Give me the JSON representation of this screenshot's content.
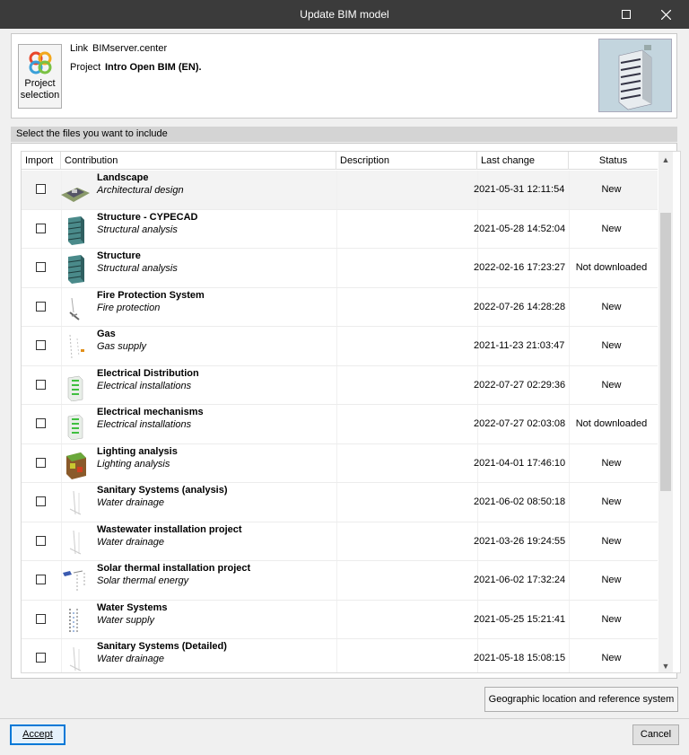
{
  "window": {
    "title": "Update BIM model"
  },
  "header": {
    "project_button_label": "Project\nselection",
    "link_label": "Link",
    "link_value": "BIMserver.center",
    "project_label": "Project",
    "project_value": "Intro Open BIM (EN)."
  },
  "section_title": "Select the files you want to include",
  "table": {
    "columns": [
      "Import",
      "Contribution",
      "Description",
      "Last change",
      "Status"
    ],
    "rows": [
      {
        "name": "Landscape",
        "sub": "Architectural design",
        "description": "",
        "date": "2021-05-31 12:11:54",
        "status": "New",
        "checked": false,
        "icon": "landscape-thumb"
      },
      {
        "name": "Structure - CYPECAD",
        "sub": "Structural analysis",
        "description": "",
        "date": "2021-05-28 14:52:04",
        "status": "New",
        "checked": false,
        "icon": "structure-thumb"
      },
      {
        "name": "Structure",
        "sub": "Structural analysis",
        "description": "",
        "date": "2022-02-16 17:23:27",
        "status": "Not downloaded",
        "checked": false,
        "icon": "structure-thumb"
      },
      {
        "name": "Fire Protection System",
        "sub": "Fire protection",
        "description": "",
        "date": "2022-07-26 14:28:28",
        "status": "New",
        "checked": false,
        "icon": "fire-thumb"
      },
      {
        "name": "Gas",
        "sub": "Gas supply",
        "description": "",
        "date": "2021-11-23 21:03:47",
        "status": "New",
        "checked": false,
        "icon": "gas-thumb"
      },
      {
        "name": "Electrical Distribution",
        "sub": "Electrical installations",
        "description": "",
        "date": "2022-07-27 02:29:36",
        "status": "New",
        "checked": false,
        "icon": "electrical-thumb"
      },
      {
        "name": "Electrical mechanisms",
        "sub": "Electrical installations",
        "description": "",
        "date": "2022-07-27 02:03:08",
        "status": "Not downloaded",
        "checked": false,
        "icon": "electrical-thumb"
      },
      {
        "name": "Lighting analysis",
        "sub": "Lighting analysis",
        "description": "",
        "date": "2021-04-01 17:46:10",
        "status": "New",
        "checked": false,
        "icon": "lighting-thumb"
      },
      {
        "name": "Sanitary Systems (analysis)",
        "sub": "Water drainage",
        "description": "",
        "date": "2021-06-02 08:50:18",
        "status": "New",
        "checked": false,
        "icon": "pipes-thumb"
      },
      {
        "name": "Wastewater installation project",
        "sub": "Water drainage",
        "description": "",
        "date": "2021-03-26 19:24:55",
        "status": "New",
        "checked": false,
        "icon": "pipes-thumb"
      },
      {
        "name": "Solar thermal installation project",
        "sub": "Solar thermal energy",
        "description": "",
        "date": "2021-06-02 17:32:24",
        "status": "New",
        "checked": false,
        "icon": "solar-thumb"
      },
      {
        "name": "Water Systems",
        "sub": "Water supply",
        "description": "",
        "date": "2021-05-25 15:21:41",
        "status": "New",
        "checked": false,
        "icon": "water-thumb"
      },
      {
        "name": "Sanitary Systems (Detailed)",
        "sub": "Water drainage",
        "description": "",
        "date": "2021-05-18 15:08:15",
        "status": "New",
        "checked": false,
        "icon": "pipes-thumb"
      }
    ]
  },
  "buttons": {
    "geo": "Geographic location and reference system",
    "accept": "Accept",
    "cancel": "Cancel"
  },
  "colors": {
    "titlebar": "#3b3b3b",
    "accent": "#0078d7"
  }
}
